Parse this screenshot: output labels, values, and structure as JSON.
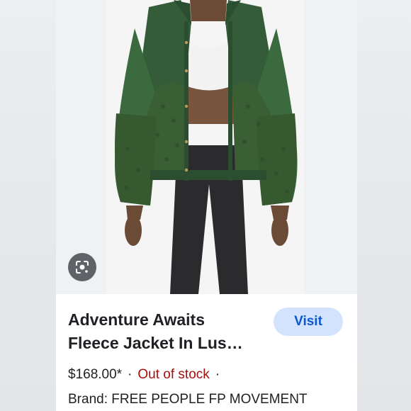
{
  "product": {
    "title_line1": "Adventure Awaits",
    "title_line2": "Fleece Jacket In Lus…",
    "price": "$168.00*",
    "separator": "·",
    "stock_status": "Out of stock",
    "brand_label": "Brand:",
    "brand": "FREE PEOPLE FP MOVEMENT"
  },
  "actions": {
    "visit_label": "Visit",
    "lens_icon": "lens-search-icon"
  },
  "colors": {
    "jacket_green": "#2f5a34",
    "fleece_green": "#3a5f35",
    "visit_bg": "#d3e3fd",
    "visit_text": "#0b57d0",
    "out_of_stock": "#a50e0e"
  }
}
